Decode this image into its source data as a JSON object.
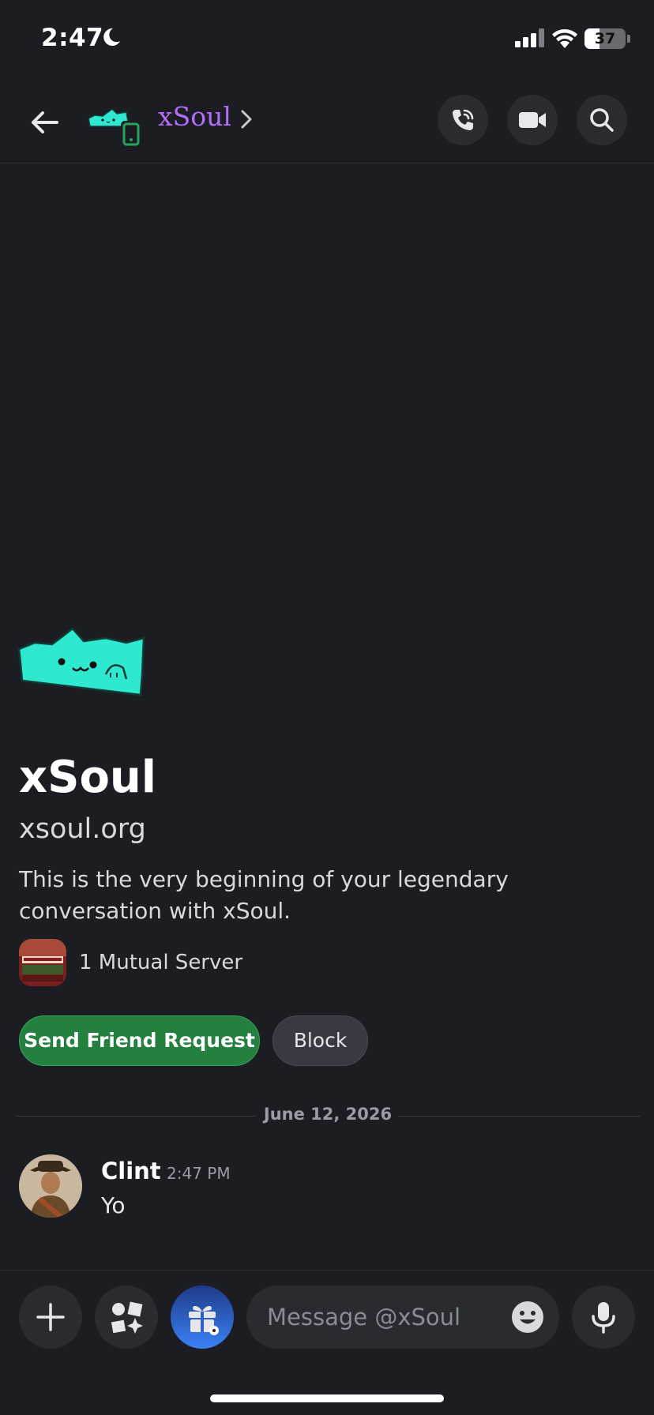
{
  "status_bar": {
    "time": "2:47",
    "battery": "37",
    "battery_level": 0.37
  },
  "header": {
    "title": "xSoul"
  },
  "intro": {
    "name": "xSoul",
    "subtitle": "xsoul.org",
    "text": "This is the very beginning of your legendary conversation with xSoul.",
    "mutual": "1 Mutual Server",
    "send_friend_request": "Send Friend Request",
    "block": "Block"
  },
  "divider": {
    "date": "June 12, 2026"
  },
  "message": {
    "author": "Clint",
    "time": "2:47 PM",
    "text": "Yo"
  },
  "composer": {
    "placeholder": "Message @xSoul"
  },
  "colors": {
    "accent_name": "#b26dfa",
    "friend_button": "#24803f",
    "background": "#1c1d22",
    "avatar_cat": "#2ee8d0"
  },
  "icons": [
    "moon-icon",
    "signal-icon",
    "wifi-icon",
    "battery-icon",
    "back-arrow-icon",
    "mobile-status-icon",
    "chevron-right-icon",
    "phone-call-icon",
    "video-camera-icon",
    "search-icon",
    "plus-icon",
    "apps-icon",
    "gift-icon",
    "emoji-icon",
    "microphone-icon"
  ]
}
